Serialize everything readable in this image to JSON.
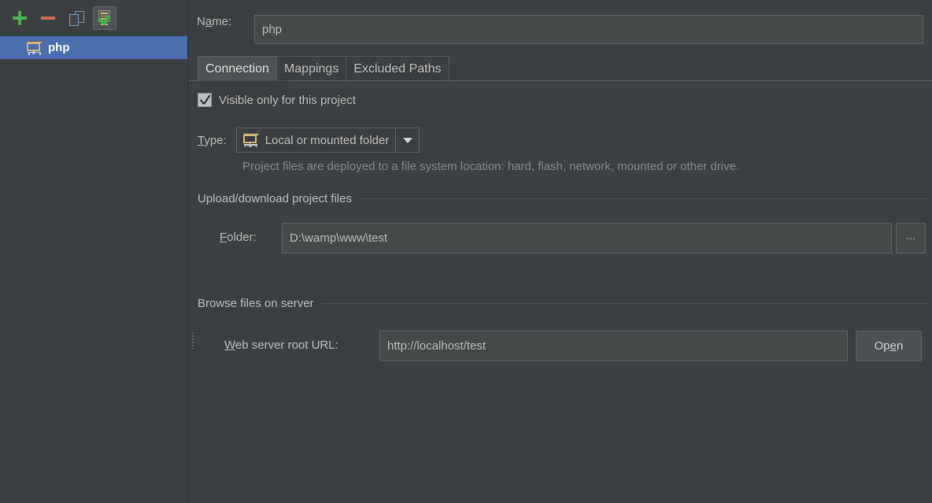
{
  "colors": {
    "background": "#3c3f41",
    "field_background": "#45494a",
    "border": "#5e6366",
    "selection_blue": "#4b6eaf",
    "text": "#bbbbbb",
    "hint_text": "#868a8c",
    "accent_green": "#4caf50",
    "accent_red": "#cf6a4c",
    "folder_yellow": "#d7b56d"
  },
  "left_panel": {
    "toolbar": {
      "add": {
        "icon": "plus-icon",
        "tooltip": "Add"
      },
      "remove": {
        "icon": "minus-icon",
        "tooltip": "Remove"
      },
      "copy": {
        "icon": "copy-icon",
        "tooltip": "Copy"
      },
      "test": {
        "icon": "test-connection-icon",
        "tooltip": "Test Connection",
        "pressed": true
      }
    },
    "servers": [
      {
        "label": "php",
        "icon": "folder-connection-icon",
        "selected": true
      }
    ]
  },
  "form": {
    "name_label": "Name:",
    "name_mnemonic": "a",
    "name_value": "php",
    "name_placeholder": ""
  },
  "tabs": [
    {
      "label": "Connection",
      "active": true
    },
    {
      "label": "Mappings",
      "active": false
    },
    {
      "label": "Excluded Paths",
      "active": false
    }
  ],
  "connection": {
    "visible_only_label": "Visible only for this project",
    "visible_only_checked": true,
    "type_label": "Type:",
    "type_mnemonic": "T",
    "type_value": "Local or mounted folder",
    "type_icon": "folder-connection-icon",
    "type_hint": "Project files are deployed to a file system location: hard, flash, network, mounted or other drive.",
    "section_upload": "Upload/download project files",
    "folder_label": "Folder:",
    "folder_mnemonic": "F",
    "folder_value": "D:\\wamp\\www\\test",
    "folder_browse_label": "...",
    "section_browse": "Browse files on server",
    "url_label_prefix": "W",
    "url_label_rest": "eb server root URL:",
    "url_value": "http://localhost/test",
    "open_button_label_a": "Op",
    "open_button_label_mn": "e",
    "open_button_label_b": "n"
  }
}
